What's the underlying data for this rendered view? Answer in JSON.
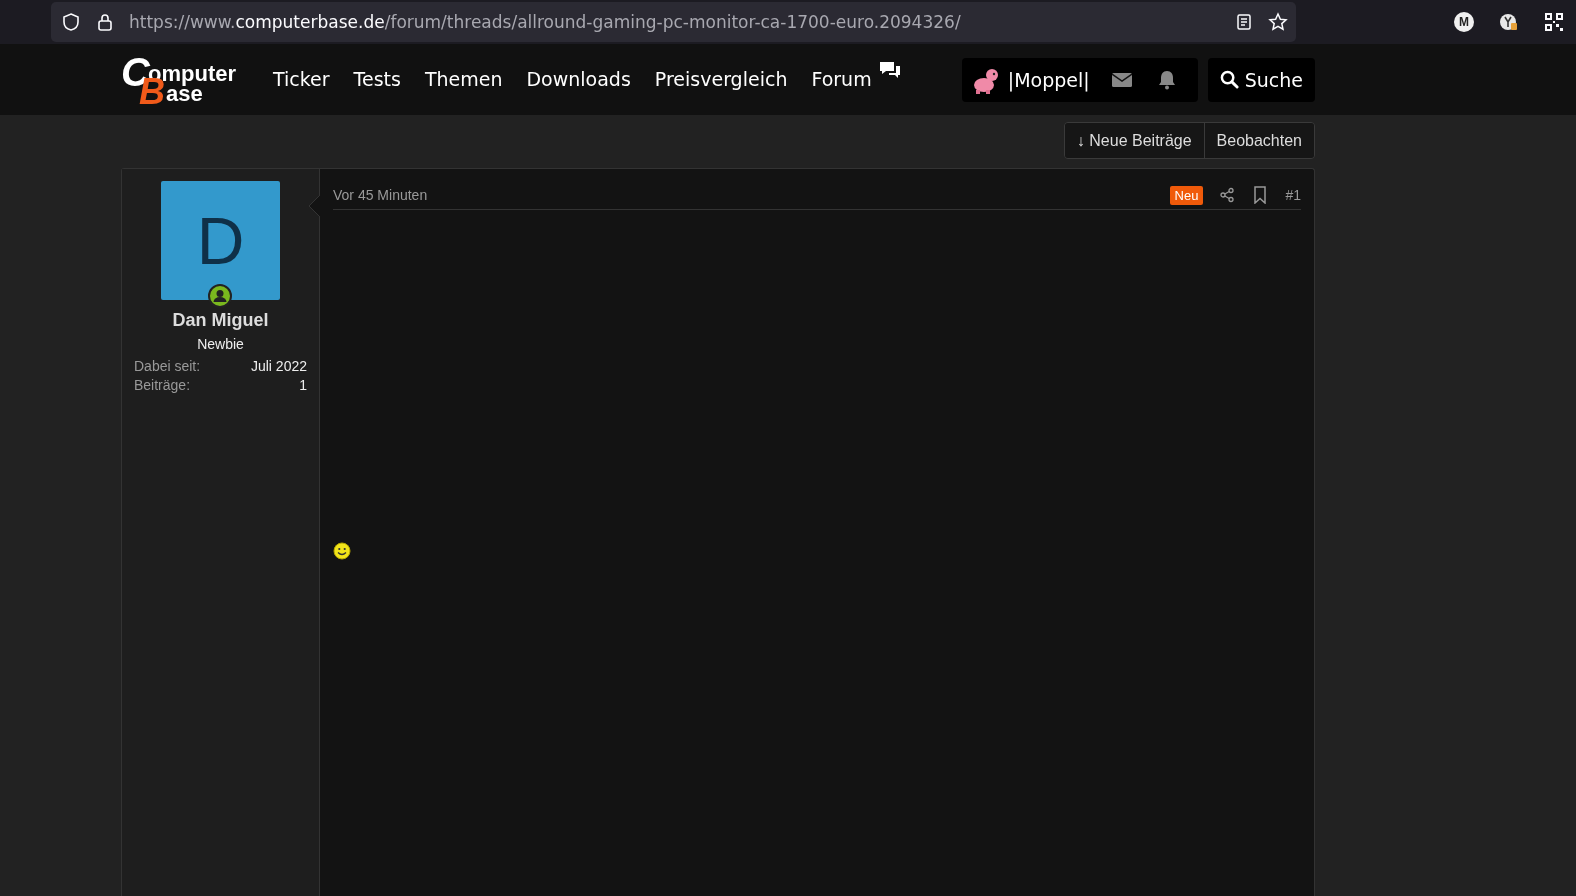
{
  "browser": {
    "url_host_prefix": "https://www.",
    "url_domain": "computerbase.de",
    "url_path": "/forum/threads/allround-gaming-pc-monitor-ca-1700-euro.2094326/",
    "profile_initial": "M"
  },
  "site": {
    "logo_top": "omputer",
    "logo_bottom": "ase",
    "logo_c": "C",
    "logo_b": "B",
    "nav": [
      {
        "label": "Ticker",
        "selected": false
      },
      {
        "label": "Tests",
        "selected": false
      },
      {
        "label": "Themen",
        "selected": false
      },
      {
        "label": "Downloads",
        "selected": false
      },
      {
        "label": "Preisvergleich",
        "selected": false
      },
      {
        "label": "Forum",
        "selected": false
      }
    ],
    "username": "|Moppel|",
    "search_label": "Suche"
  },
  "thread_actions": [
    {
      "label": "↓ Neue Beiträge"
    },
    {
      "label": "Beobachten"
    }
  ],
  "post": {
    "author": {
      "initial": "D",
      "name": "Dan Miguel",
      "title": "Newbie",
      "online": true,
      "stats": [
        {
          "label": "Dabei seit:",
          "value": "Juli 2022"
        },
        {
          "label": "Beiträge:",
          "value": "1"
        }
      ]
    },
    "time": "Vor 45 Minuten",
    "badge": "Neu",
    "number": "#1"
  }
}
